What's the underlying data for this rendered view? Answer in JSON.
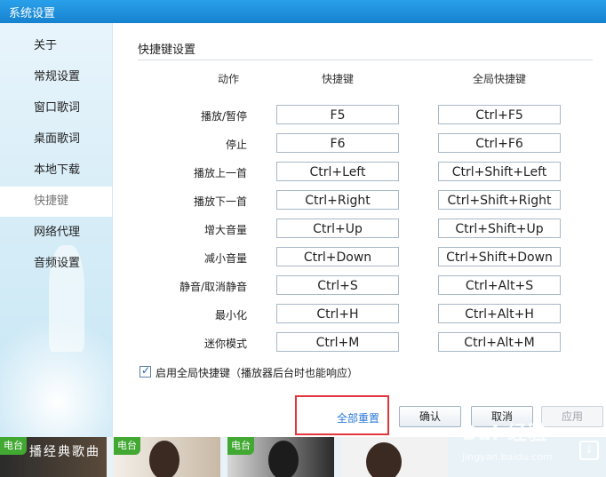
{
  "window": {
    "title": "系统设置"
  },
  "sidebar": {
    "items": [
      {
        "label": "关于"
      },
      {
        "label": "常规设置"
      },
      {
        "label": "窗口歌词"
      },
      {
        "label": "桌面歌词"
      },
      {
        "label": "本地下载"
      },
      {
        "label": "快捷键",
        "active": true
      },
      {
        "label": "网络代理"
      },
      {
        "label": "音频设置"
      }
    ]
  },
  "shortcuts": {
    "section_title": "快捷键设置",
    "columns": {
      "action": "动作",
      "hotkey": "快捷键",
      "global": "全局快捷键"
    },
    "rows": [
      {
        "action": "播放/暂停",
        "hotkey": "F5",
        "global": "Ctrl+F5"
      },
      {
        "action": "停止",
        "hotkey": "F6",
        "global": "Ctrl+F6"
      },
      {
        "action": "播放上一首",
        "hotkey": "Ctrl+Left",
        "global": "Ctrl+Shift+Left"
      },
      {
        "action": "播放下一首",
        "hotkey": "Ctrl+Right",
        "global": "Ctrl+Shift+Right"
      },
      {
        "action": "增大音量",
        "hotkey": "Ctrl+Up",
        "global": "Ctrl+Shift+Up"
      },
      {
        "action": "减小音量",
        "hotkey": "Ctrl+Down",
        "global": "Ctrl+Shift+Down"
      },
      {
        "action": "静音/取消静音",
        "hotkey": "Ctrl+S",
        "global": "Ctrl+Alt+S"
      },
      {
        "action": "最小化",
        "hotkey": "Ctrl+H",
        "global": "Ctrl+Alt+H"
      },
      {
        "action": "迷你模式",
        "hotkey": "Ctrl+M",
        "global": "Ctrl+Alt+M"
      }
    ],
    "enable_global_label": "启用全局快捷键（播放器后台时也能响应）",
    "enable_global_checked": true
  },
  "footer": {
    "reset_label": "全部重置",
    "ok_label": "确认",
    "cancel_label": "取消",
    "apply_label": "应用"
  },
  "bottom_strip": {
    "badge": "电台",
    "tile_text": "播经典歌曲"
  },
  "watermark": {
    "logo": "Bai 经验",
    "url": "jingyan.baidu.com"
  },
  "colors": {
    "titlebar": "#1682cf",
    "link": "#2a7ad9",
    "highlight": "#e0363c",
    "badge": "#41a832"
  }
}
